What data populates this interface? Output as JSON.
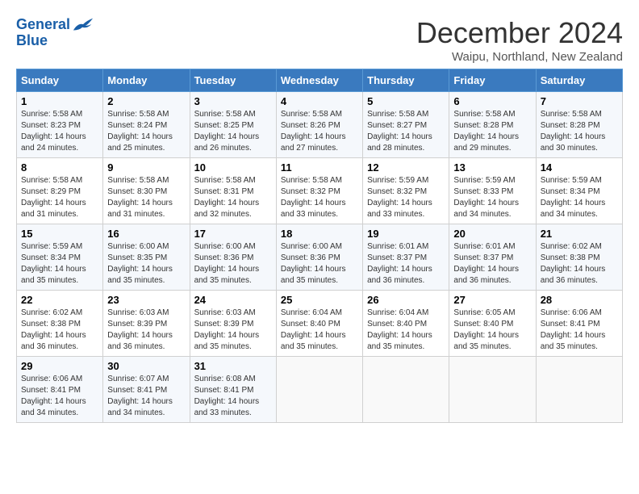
{
  "logo": {
    "line1": "General",
    "line2": "Blue"
  },
  "title": "December 2024",
  "subtitle": "Waipu, Northland, New Zealand",
  "days_of_week": [
    "Sunday",
    "Monday",
    "Tuesday",
    "Wednesday",
    "Thursday",
    "Friday",
    "Saturday"
  ],
  "weeks": [
    [
      {
        "day": "1",
        "info": "Sunrise: 5:58 AM\nSunset: 8:23 PM\nDaylight: 14 hours\nand 24 minutes."
      },
      {
        "day": "2",
        "info": "Sunrise: 5:58 AM\nSunset: 8:24 PM\nDaylight: 14 hours\nand 25 minutes."
      },
      {
        "day": "3",
        "info": "Sunrise: 5:58 AM\nSunset: 8:25 PM\nDaylight: 14 hours\nand 26 minutes."
      },
      {
        "day": "4",
        "info": "Sunrise: 5:58 AM\nSunset: 8:26 PM\nDaylight: 14 hours\nand 27 minutes."
      },
      {
        "day": "5",
        "info": "Sunrise: 5:58 AM\nSunset: 8:27 PM\nDaylight: 14 hours\nand 28 minutes."
      },
      {
        "day": "6",
        "info": "Sunrise: 5:58 AM\nSunset: 8:28 PM\nDaylight: 14 hours\nand 29 minutes."
      },
      {
        "day": "7",
        "info": "Sunrise: 5:58 AM\nSunset: 8:28 PM\nDaylight: 14 hours\nand 30 minutes."
      }
    ],
    [
      {
        "day": "8",
        "info": "Sunrise: 5:58 AM\nSunset: 8:29 PM\nDaylight: 14 hours\nand 31 minutes."
      },
      {
        "day": "9",
        "info": "Sunrise: 5:58 AM\nSunset: 8:30 PM\nDaylight: 14 hours\nand 31 minutes."
      },
      {
        "day": "10",
        "info": "Sunrise: 5:58 AM\nSunset: 8:31 PM\nDaylight: 14 hours\nand 32 minutes."
      },
      {
        "day": "11",
        "info": "Sunrise: 5:58 AM\nSunset: 8:32 PM\nDaylight: 14 hours\nand 33 minutes."
      },
      {
        "day": "12",
        "info": "Sunrise: 5:59 AM\nSunset: 8:32 PM\nDaylight: 14 hours\nand 33 minutes."
      },
      {
        "day": "13",
        "info": "Sunrise: 5:59 AM\nSunset: 8:33 PM\nDaylight: 14 hours\nand 34 minutes."
      },
      {
        "day": "14",
        "info": "Sunrise: 5:59 AM\nSunset: 8:34 PM\nDaylight: 14 hours\nand 34 minutes."
      }
    ],
    [
      {
        "day": "15",
        "info": "Sunrise: 5:59 AM\nSunset: 8:34 PM\nDaylight: 14 hours\nand 35 minutes."
      },
      {
        "day": "16",
        "info": "Sunrise: 6:00 AM\nSunset: 8:35 PM\nDaylight: 14 hours\nand 35 minutes."
      },
      {
        "day": "17",
        "info": "Sunrise: 6:00 AM\nSunset: 8:36 PM\nDaylight: 14 hours\nand 35 minutes."
      },
      {
        "day": "18",
        "info": "Sunrise: 6:00 AM\nSunset: 8:36 PM\nDaylight: 14 hours\nand 35 minutes."
      },
      {
        "day": "19",
        "info": "Sunrise: 6:01 AM\nSunset: 8:37 PM\nDaylight: 14 hours\nand 36 minutes."
      },
      {
        "day": "20",
        "info": "Sunrise: 6:01 AM\nSunset: 8:37 PM\nDaylight: 14 hours\nand 36 minutes."
      },
      {
        "day": "21",
        "info": "Sunrise: 6:02 AM\nSunset: 8:38 PM\nDaylight: 14 hours\nand 36 minutes."
      }
    ],
    [
      {
        "day": "22",
        "info": "Sunrise: 6:02 AM\nSunset: 8:38 PM\nDaylight: 14 hours\nand 36 minutes."
      },
      {
        "day": "23",
        "info": "Sunrise: 6:03 AM\nSunset: 8:39 PM\nDaylight: 14 hours\nand 36 minutes."
      },
      {
        "day": "24",
        "info": "Sunrise: 6:03 AM\nSunset: 8:39 PM\nDaylight: 14 hours\nand 35 minutes."
      },
      {
        "day": "25",
        "info": "Sunrise: 6:04 AM\nSunset: 8:40 PM\nDaylight: 14 hours\nand 35 minutes."
      },
      {
        "day": "26",
        "info": "Sunrise: 6:04 AM\nSunset: 8:40 PM\nDaylight: 14 hours\nand 35 minutes."
      },
      {
        "day": "27",
        "info": "Sunrise: 6:05 AM\nSunset: 8:40 PM\nDaylight: 14 hours\nand 35 minutes."
      },
      {
        "day": "28",
        "info": "Sunrise: 6:06 AM\nSunset: 8:41 PM\nDaylight: 14 hours\nand 35 minutes."
      }
    ],
    [
      {
        "day": "29",
        "info": "Sunrise: 6:06 AM\nSunset: 8:41 PM\nDaylight: 14 hours\nand 34 minutes."
      },
      {
        "day": "30",
        "info": "Sunrise: 6:07 AM\nSunset: 8:41 PM\nDaylight: 14 hours\nand 34 minutes."
      },
      {
        "day": "31",
        "info": "Sunrise: 6:08 AM\nSunset: 8:41 PM\nDaylight: 14 hours\nand 33 minutes."
      },
      {
        "day": "",
        "info": ""
      },
      {
        "day": "",
        "info": ""
      },
      {
        "day": "",
        "info": ""
      },
      {
        "day": "",
        "info": ""
      }
    ]
  ]
}
